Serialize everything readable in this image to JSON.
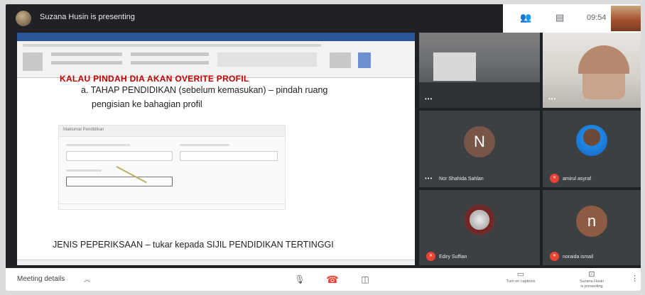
{
  "presenter": {
    "text": "Suzana Husin is presenting"
  },
  "top_right": {
    "clock": "09:54",
    "people_icon": "people-icon",
    "chat_icon": "chat-icon"
  },
  "document": {
    "line_top": "KALAU PINDAH DIA AKAN OVERITE PROFIL",
    "line_a1": "a. TAHAP PENDIDIKAN (sebelum kemasukan) – pindah ruang",
    "line_a2": "pengisian ke bahagian profil",
    "form_title": "Maklumat Pendidikan",
    "line_jenis": "JENIS PEPERIKSAAN – tukar kepada SIJIL PENDIDIKAN TERTINGGI"
  },
  "participants": [
    {
      "name": "",
      "type": "video",
      "muted": false
    },
    {
      "name": "",
      "type": "video",
      "muted": false
    },
    {
      "name": "Nor Shahida Sahlan",
      "type": "letter",
      "initial": "N",
      "color": "#795548",
      "muted": false
    },
    {
      "name": "amirul asyraf",
      "type": "photo",
      "muted": true
    },
    {
      "name": "Ediry Suffian",
      "type": "photo",
      "muted": true
    },
    {
      "name": "noraida ismail",
      "type": "letter",
      "initial": "n",
      "color": "#8d5a44",
      "muted": true
    }
  ],
  "bottom": {
    "meeting_details": "Meeting details",
    "captions_label": "Turn on captions",
    "presenting_label_1": "Suzana Husin",
    "presenting_label_2": "is presenting"
  },
  "colors": {
    "accent_red": "#ea4335",
    "bg_dark": "#202124",
    "tile": "#3c4043"
  }
}
